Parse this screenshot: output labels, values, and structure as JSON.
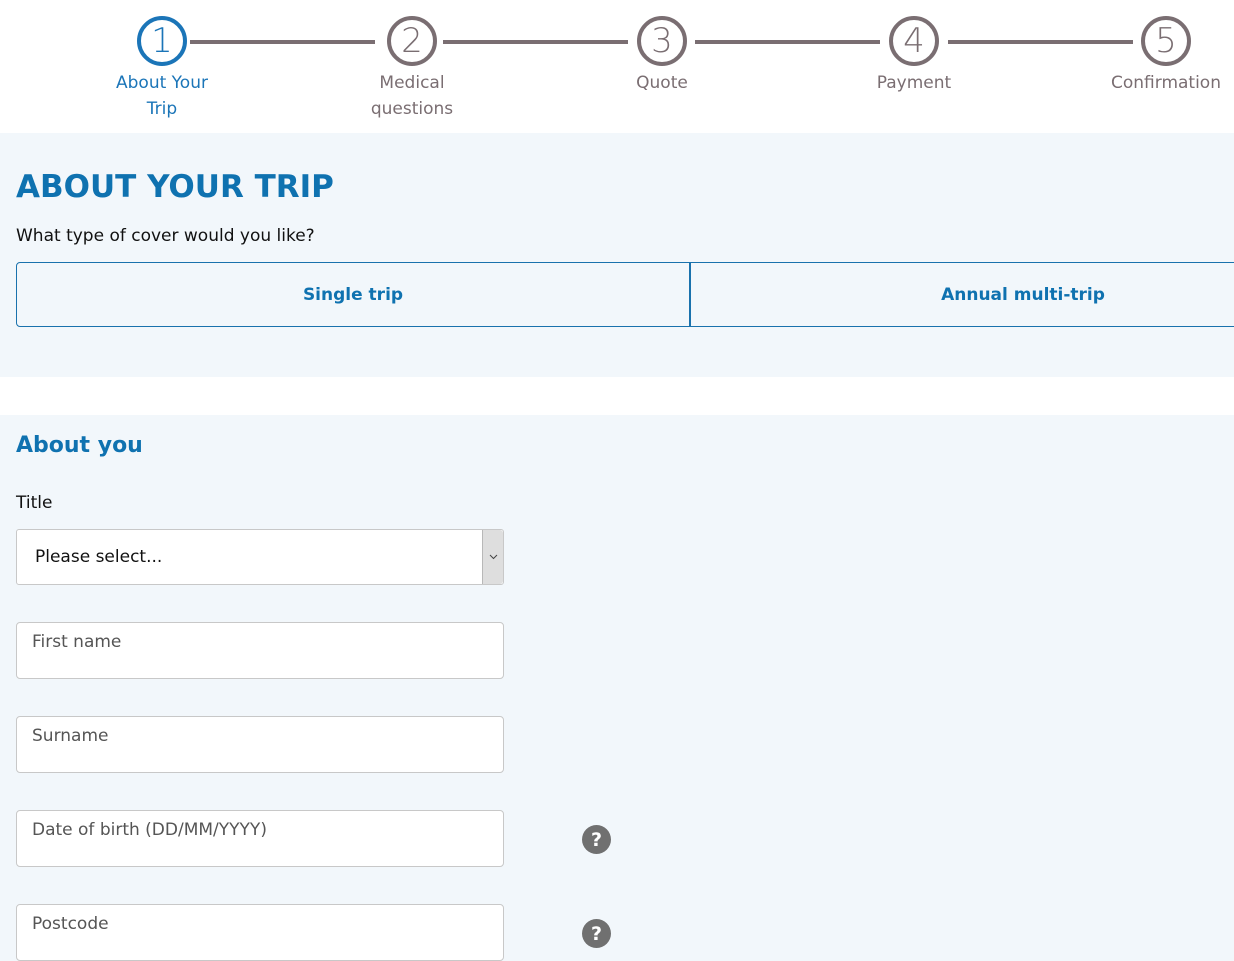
{
  "stepper": {
    "steps": [
      {
        "number": "1",
        "label_line1": "About Your",
        "label_line2": "Trip",
        "state": "active"
      },
      {
        "number": "2",
        "label_line1": "Medical",
        "label_line2": "questions",
        "state": "inactive"
      },
      {
        "number": "3",
        "label_line1": "Quote",
        "label_line2": "",
        "state": "inactive"
      },
      {
        "number": "4",
        "label_line1": "Payment",
        "label_line2": "",
        "state": "inactive"
      },
      {
        "number": "5",
        "label_line1": "Confirmation",
        "label_line2": "",
        "state": "inactive"
      }
    ],
    "active_color": "#1b75b8",
    "inactive_color": "#7a6e72"
  },
  "trip": {
    "heading": "ABOUT YOUR TRIP",
    "question": "What type of cover would you like?",
    "options": [
      {
        "label": "Single trip"
      },
      {
        "label": "Annual multi-trip"
      }
    ]
  },
  "about_you": {
    "heading": "About you",
    "title_label": "Title",
    "title_selected": "Please select...",
    "fields": [
      {
        "placeholder": "First name",
        "has_help": false
      },
      {
        "placeholder": "Surname",
        "has_help": false
      },
      {
        "placeholder": "Date of birth (DD/MM/YYYY)",
        "has_help": true
      },
      {
        "placeholder": "Postcode",
        "has_help": true
      }
    ],
    "help_glyph": "?"
  },
  "colors": {
    "brand": "#0f72b0",
    "section_bg": "#f2f7fb"
  }
}
